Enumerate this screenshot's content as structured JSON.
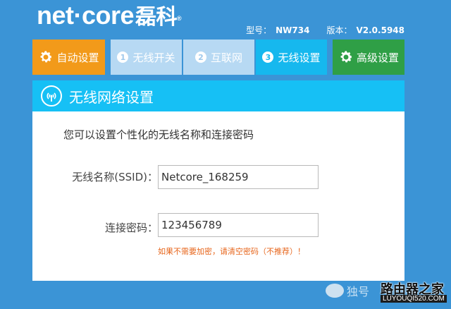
{
  "header": {
    "logo_text": "net·core",
    "logo_cn": "磊科",
    "logo_reg": "®",
    "model_label": "型号：",
    "model_value": "NW734",
    "version_label": "版本：",
    "version_value": "V2.0.5948"
  },
  "nav": {
    "auto_setup": {
      "label": "自动设置",
      "icon": "gear-icon"
    },
    "steps": [
      {
        "number": "1",
        "label": "无线开关"
      },
      {
        "number": "2",
        "label": "互联网"
      },
      {
        "number": "3",
        "label": "无线设置"
      }
    ],
    "advanced": {
      "label": "高级设置",
      "icon": "gear-icon"
    },
    "active_step": 3
  },
  "panel": {
    "title": "无线网络设置",
    "icon": "wifi-signal-icon",
    "intro": "您可以设置个性化的无线名称和连接密码",
    "ssid_label": "无线名称(SSID)：",
    "ssid_value": "Netcore_168259",
    "password_label": "连接密码：",
    "password_value": "123456789",
    "hint": "如果不需要加密，请清空密码（不推荐）！"
  },
  "watermark": {
    "channel": "独号",
    "brand": "路由器之家",
    "url": "LUYOUQI520.COM"
  },
  "colors": {
    "background": "#3b94d6",
    "auto_tab": "#f29a1a",
    "step_tab": "#b7d9f3",
    "active_tab": "#16b8ee",
    "advanced_tab": "#2f9f46",
    "panel_header": "#16c0f5",
    "hint": "#e7661c"
  }
}
